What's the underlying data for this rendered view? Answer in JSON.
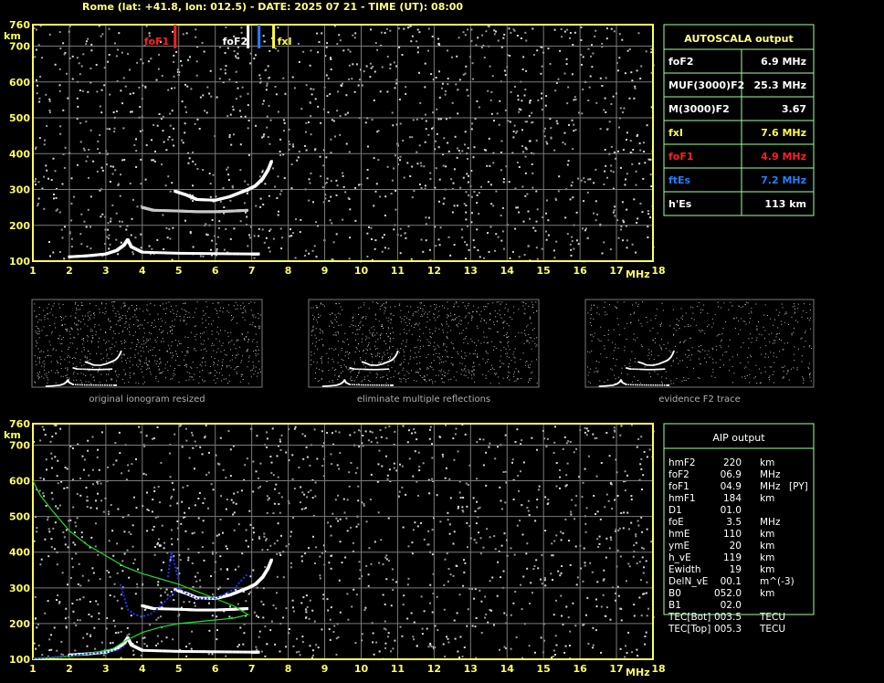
{
  "header": {
    "title": "Rome (lat: +41.8, lon: 012.5) - DATE: 2025 07 21 - TIME (UT): 08:00"
  },
  "colors": {
    "background": "#000000",
    "grid": "#7a7a7a",
    "frame_panel": "#a0ffa0",
    "fof1": "#ff2020",
    "foes": "#2080ff",
    "fxi": "#ffff40",
    "green_profile": "#20e020",
    "blue_fit": "#2030ff"
  },
  "autoscala": {
    "title": "AUTOSCALA output",
    "rows": [
      {
        "label": "foF2",
        "value": "6.9 MHz",
        "color": "#ffffff"
      },
      {
        "label": "MUF(3000)F2",
        "value": "25.3 MHz",
        "color": "#ffffff"
      },
      {
        "label": "M(3000)F2",
        "value": "3.67",
        "color": "#ffffff"
      },
      {
        "label": "fxI",
        "value": "7.6 MHz",
        "color": "#ffff40"
      },
      {
        "label": "foF1",
        "value": "4.9 MHz",
        "color": "#ff2020"
      },
      {
        "label": "ftEs",
        "value": "7.2 MHz",
        "color": "#2080ff"
      },
      {
        "label": "h'Es",
        "value": "113    km",
        "color": "#ffffff"
      }
    ]
  },
  "aip": {
    "title": "AIP output",
    "rows": [
      {
        "label": "hmF2",
        "value": "220",
        "unit": "km",
        "extra": ""
      },
      {
        "label": "foF2",
        "value": "06.9",
        "unit": "MHz",
        "extra": ""
      },
      {
        "label": "foF1",
        "value": "04.9",
        "unit": "MHz",
        "extra": "[PY]"
      },
      {
        "label": "hmF1",
        "value": "184",
        "unit": "km",
        "extra": ""
      },
      {
        "label": "D1",
        "value": "01.0",
        "unit": "",
        "extra": ""
      },
      {
        "label": "foE",
        "value": "3.5",
        "unit": "MHz",
        "extra": ""
      },
      {
        "label": "hmE",
        "value": "110",
        "unit": "km",
        "extra": ""
      },
      {
        "label": "ymE",
        "value": "20",
        "unit": "km",
        "extra": ""
      },
      {
        "label": "h_vE",
        "value": "119",
        "unit": "km",
        "extra": ""
      },
      {
        "label": "Ewidth",
        "value": "19",
        "unit": "km",
        "extra": ""
      },
      {
        "label": "DelN_vE",
        "value": "00.1",
        "unit": "m^(-3)",
        "extra": ""
      },
      {
        "label": "B0",
        "value": "052.0",
        "unit": "km",
        "extra": ""
      },
      {
        "label": "B1",
        "value": "02.0",
        "unit": "",
        "extra": ""
      },
      {
        "label": "TEC[Bot]",
        "value": "003.5",
        "unit": "TECU",
        "extra": ""
      },
      {
        "label": "TEC[Top]",
        "value": "005.3",
        "unit": "TECU",
        "extra": ""
      }
    ]
  },
  "thumbnails": {
    "captions": [
      "original ionogram resized",
      "eliminate multiple reflections",
      "evidence F2 trace"
    ]
  },
  "chart_data": [
    {
      "type": "scatter",
      "title": "",
      "xlabel": "MHz",
      "ylabel": "km",
      "xlim": [
        1,
        18
      ],
      "ylim": [
        100,
        760
      ],
      "x_ticks": [
        1,
        2,
        3,
        4,
        5,
        6,
        7,
        8,
        9,
        10,
        11,
        12,
        13,
        14,
        15,
        16,
        17,
        18
      ],
      "y_ticks": [
        100,
        200,
        300,
        400,
        500,
        600,
        700,
        760
      ],
      "grid": true,
      "markers": [
        {
          "name": "foF1",
          "x": 4.9,
          "color": "#ff2020"
        },
        {
          "name": "foF2",
          "x": 6.9,
          "color": "#ffffff"
        },
        {
          "name": "ftEs",
          "x": 7.2,
          "color": "#2080ff"
        },
        {
          "name": "fxI",
          "x": 7.6,
          "color": "#ffff40"
        }
      ],
      "series": [
        {
          "x": [
            2.0,
            2.5,
            3.0,
            3.3,
            3.5,
            3.6,
            3.7,
            4.0,
            5.0,
            6.0,
            7.0,
            7.2
          ],
          "y": [
            112,
            115,
            120,
            130,
            145,
            160,
            140,
            125,
            122,
            121,
            120,
            120
          ]
        },
        {
          "x": [
            4.9,
            5.2,
            5.5,
            6.0,
            6.4,
            6.7,
            6.9,
            7.1,
            7.3,
            7.45,
            7.55
          ],
          "y": [
            295,
            285,
            272,
            270,
            280,
            292,
            300,
            310,
            330,
            355,
            380
          ]
        },
        {
          "x": [
            4.0,
            4.3,
            5.0,
            5.5,
            6.0,
            6.5,
            6.9
          ],
          "y": [
            250,
            242,
            240,
            238,
            238,
            240,
            242
          ]
        }
      ]
    },
    {
      "type": "line",
      "title": "",
      "xlabel": "MHz",
      "ylabel": "km",
      "xlim": [
        1,
        18
      ],
      "ylim": [
        100,
        760
      ],
      "x_ticks": [
        1,
        2,
        3,
        4,
        5,
        6,
        7,
        8,
        9,
        10,
        11,
        12,
        13,
        14,
        15,
        16,
        17,
        18
      ],
      "y_ticks": [
        100,
        200,
        300,
        400,
        500,
        600,
        700,
        760
      ],
      "grid": true,
      "series": [
        {
          "x": [
            1.0,
            1.2,
            1.5,
            2.0,
            2.5,
            3.0,
            3.5,
            4.0,
            4.5,
            5.0,
            5.5,
            6.0,
            6.5,
            6.9,
            6.5,
            6.0,
            5.5,
            5.0,
            4.5,
            4.0,
            3.5,
            3.2,
            3.0,
            2.5,
            2.0,
            1.5,
            1.0
          ],
          "y": [
            600,
            560,
            520,
            460,
            420,
            390,
            360,
            340,
            325,
            310,
            290,
            270,
            250,
            225,
            215,
            210,
            205,
            200,
            190,
            175,
            150,
            130,
            125,
            115,
            108,
            104,
            102
          ]
        },
        {
          "x": [
            3.4,
            3.6,
            3.8,
            4.0,
            4.2,
            4.4,
            4.6,
            4.8,
            5.0,
            5.2,
            5.5,
            6.0,
            6.3,
            6.5,
            6.7,
            6.9
          ],
          "y": [
            310,
            240,
            225,
            220,
            225,
            240,
            260,
            280,
            300,
            285,
            270,
            270,
            285,
            295,
            320,
            340
          ]
        },
        {
          "x": [
            4.7,
            4.8,
            4.9,
            5.0
          ],
          "y": [
            330,
            400,
            360,
            320
          ]
        },
        {
          "x": [
            1.0,
            1.5,
            2.0,
            2.5,
            3.0,
            3.3,
            3.5
          ],
          "y": [
            102,
            106,
            110,
            115,
            120,
            125,
            135
          ]
        }
      ]
    }
  ]
}
